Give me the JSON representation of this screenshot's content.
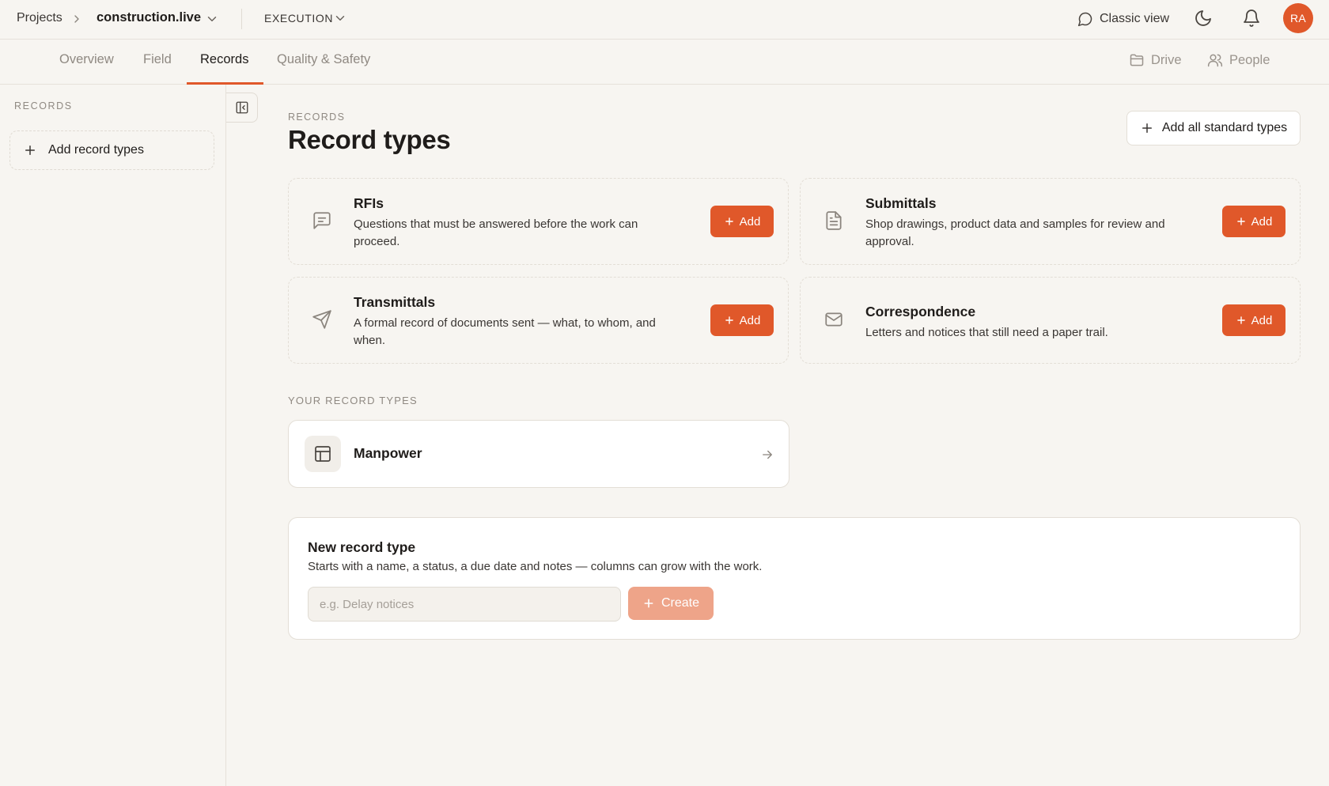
{
  "breadcrumb": {
    "projects": "Projects",
    "project": "construction.live"
  },
  "phase": "EXECUTION",
  "topbar": {
    "classic_view": "Classic view",
    "avatar_initials": "RA"
  },
  "tabs": [
    {
      "label": "Overview"
    },
    {
      "label": "Field"
    },
    {
      "label": "Records",
      "active": true
    },
    {
      "label": "Quality & Safety"
    }
  ],
  "subnav_right": {
    "drive": "Drive",
    "people": "People"
  },
  "sidebar": {
    "heading": "RECORDS",
    "add_label": "Add record types"
  },
  "main": {
    "eyebrow": "RECORDS",
    "title": "Record types",
    "add_all_label": "Add all standard types",
    "standard_types": [
      {
        "title": "RFIs",
        "description": "Questions that must be answered before the work can proceed.",
        "icon": "message-square-icon",
        "add_label": "Add"
      },
      {
        "title": "Submittals",
        "description": "Shop drawings, product data and samples for review and approval.",
        "icon": "file-text-icon",
        "add_label": "Add"
      },
      {
        "title": "Transmittals",
        "description": "A formal record of documents sent — what, to whom, and when.",
        "icon": "send-icon",
        "add_label": "Add"
      },
      {
        "title": "Correspondence",
        "description": "Letters and notices that still need a paper trail.",
        "icon": "mail-icon",
        "add_label": "Add"
      }
    ],
    "your_types_label": "YOUR RECORD TYPES",
    "your_types": [
      {
        "name": "Manpower",
        "icon": "table-icon"
      }
    ],
    "new_type": {
      "title": "New record type",
      "description": "Starts with a name, a status, a due date and notes — columns can grow with the work.",
      "placeholder": "e.g. Delay notices",
      "value": "",
      "create_label": "Create"
    }
  },
  "colors": {
    "accent": "#e0582a",
    "accent_disabled": "#eea489",
    "background": "#f7f5f1"
  }
}
